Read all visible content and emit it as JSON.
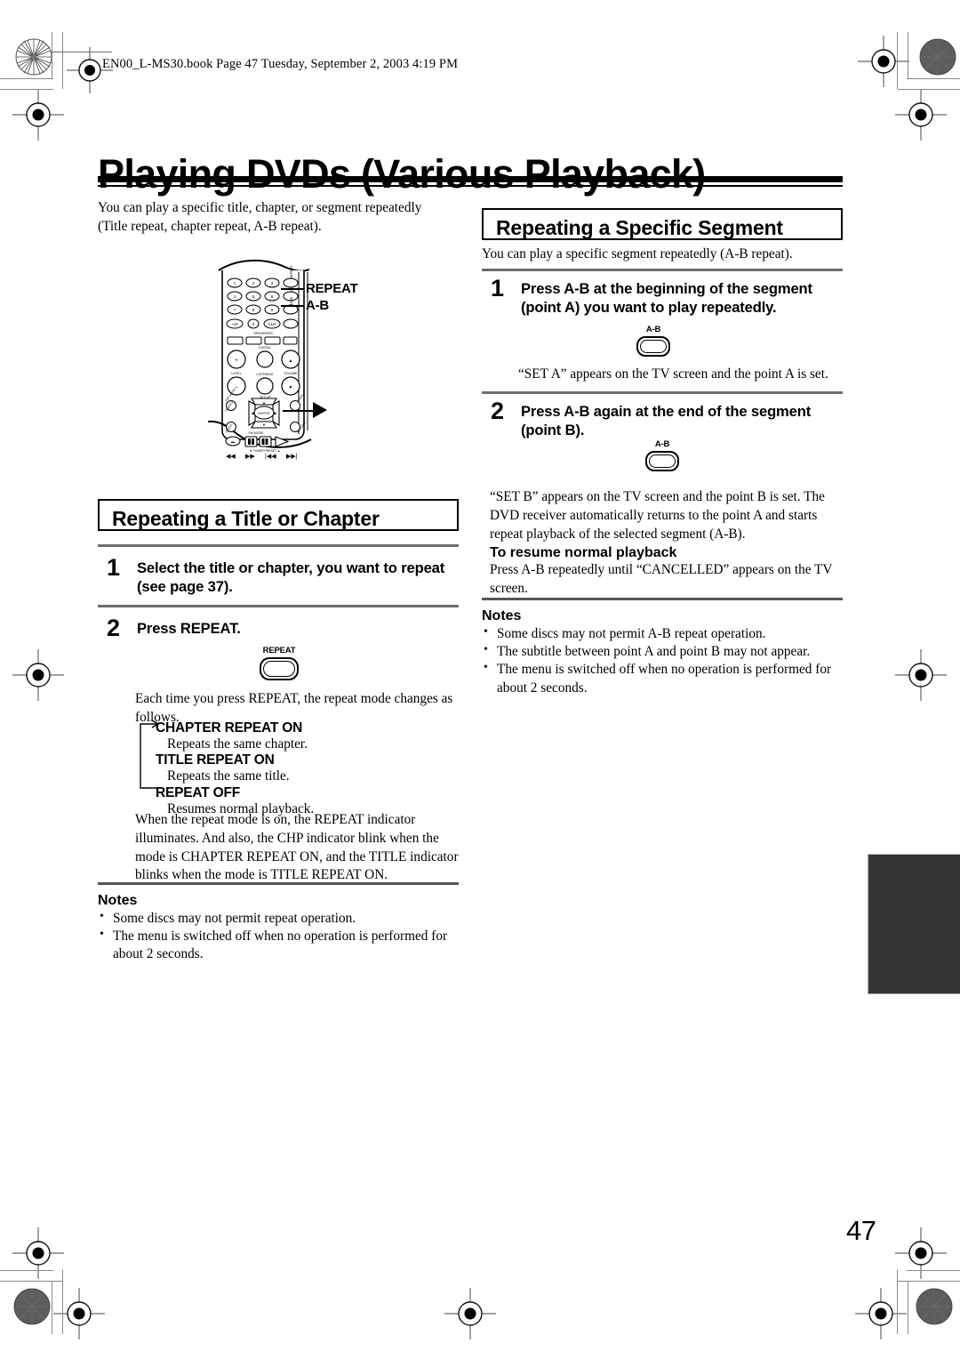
{
  "header": {
    "file_line": "EN00_L-MS30.book  Page 47  Tuesday, September 2, 2003  4:19 PM"
  },
  "page_title": "Playing DVDs (Various Playback)",
  "page_number": "47",
  "left_column": {
    "intro": "You can play a specific title, chapter, or segment repeatedly (Title repeat, chapter repeat, A-B repeat).",
    "remote_callouts": [
      "REPEAT",
      "A-B"
    ],
    "section_heading": "Repeating a Title or Chapter",
    "steps": [
      {
        "num": "1",
        "text": "Select the title or chapter, you want to repeat (see page 37)."
      },
      {
        "num": "2",
        "text": "Press REPEAT."
      }
    ],
    "button_pictogram": {
      "label": "REPEAT"
    },
    "after_button_text": "Each time you press REPEAT, the repeat mode changes as follows.",
    "repeat_modes": [
      {
        "mode": "CHAPTER REPEAT ON",
        "desc": "Repeats the same chapter."
      },
      {
        "mode": "TITLE REPEAT ON",
        "desc": "Repeats the same title."
      },
      {
        "mode": "REPEAT OFF",
        "desc": "Resumes normal playback."
      }
    ],
    "indicator_paragraph": "When the repeat mode is on, the REPEAT indicator illuminates. And also, the CHP indicator blink when the mode is CHAPTER REPEAT ON, and the TITLE indicator blinks when the mode is TITLE REPEAT ON.",
    "notes": {
      "title": "Notes",
      "items": [
        "Some discs may not permit repeat operation.",
        "The menu is switched off when no operation is performed for about 2 seconds."
      ]
    }
  },
  "right_column": {
    "section_heading": "Repeating a Specific Segment",
    "intro": "You can play a specific segment repeatedly (A-B repeat).",
    "steps": [
      {
        "num": "1",
        "text": "Press A-B at the beginning of the segment (point A) you want to play repeatedly."
      },
      {
        "num": "2",
        "text": "Press A-B again at the end of the segment (point B)."
      }
    ],
    "button_pictogram_1": {
      "label": "A-B"
    },
    "button_pictogram_2": {
      "label": "A-B"
    },
    "set_a_text": "“SET A” appears on the TV screen and the point A is set.",
    "set_b_text": "“SET B” appears on the TV screen and the point B is set. The DVD receiver automatically returns to the point A and starts repeat playback of the selected segment (A-B).",
    "resume_heading": "To resume normal playback",
    "resume_text": "Press A-B repeatedly until “CANCELLED” appears on the TV screen.",
    "notes": {
      "title": "Notes",
      "items": [
        "Some discs may not permit A-B repeat operation.",
        "The subtitle between point A and point B may not appear.",
        "The menu is switched off when no operation is performed for about 2 seconds."
      ]
    }
  },
  "colors": {
    "ink": "#000000",
    "rule": "#6d6d6d",
    "tab": "#333333"
  }
}
